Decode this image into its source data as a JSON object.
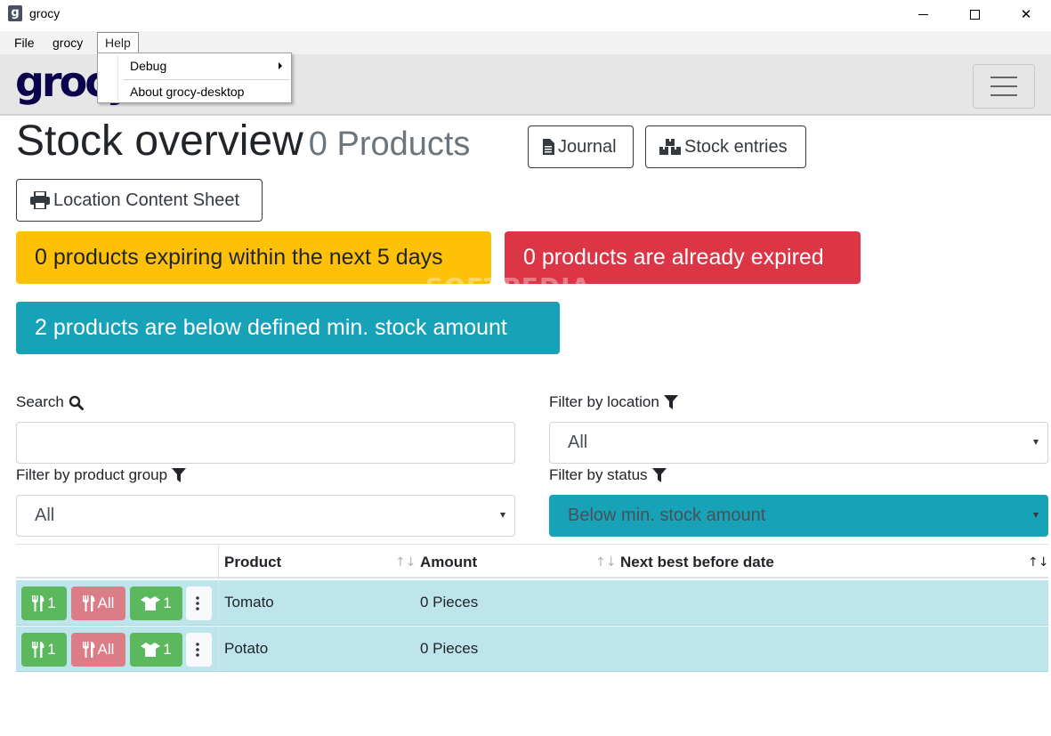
{
  "window": {
    "app_icon_letter": "g",
    "title": "grocy",
    "minimize_label": "",
    "close_glyph": "✕"
  },
  "menubar": {
    "file": "File",
    "grocy": "grocy",
    "help": "Help"
  },
  "help_menu": {
    "items": [
      {
        "label": "Debug",
        "has_submenu": true
      },
      {
        "label": "About grocy-desktop",
        "has_submenu": false
      }
    ]
  },
  "navbar": {
    "logo_text": "grocy",
    "menu_icon": "hamburger-icon"
  },
  "header": {
    "title": "Stock overview",
    "count": "0 Products",
    "journal_label": "Journal",
    "stock_entries_label": "Stock entries",
    "location_sheet_label": "Location Content Sheet"
  },
  "alerts": {
    "expiring": "0 products expiring within the next 5 days",
    "expired": "0 products are already expired",
    "below_min": "2 products are below defined min. stock amount"
  },
  "filters": {
    "search_label": "Search",
    "search_value": "",
    "location_label": "Filter by location",
    "location_value": "All",
    "group_label": "Filter by product group",
    "group_value": "All",
    "status_label": "Filter by status",
    "status_value": "Below min. stock amount"
  },
  "table": {
    "columns": [
      "Product",
      "Amount",
      "Next best before date"
    ],
    "sort_glyph": "↑↓",
    "rows": [
      {
        "product": "Tomato",
        "amount": "0 Pieces",
        "next_best_before": "",
        "consume_one": "1",
        "consume_all": "All",
        "open_one": "1"
      },
      {
        "product": "Potato",
        "amount": "0 Pieces",
        "next_best_before": "",
        "consume_one": "1",
        "consume_all": "All",
        "open_one": "1"
      }
    ]
  },
  "colors": {
    "warning": "#ffc107",
    "danger": "#dc3545",
    "info": "#17a2b8",
    "success": "#5cb85c",
    "row_highlight": "#bee5eb"
  },
  "watermark": "SOFTPEDIA"
}
